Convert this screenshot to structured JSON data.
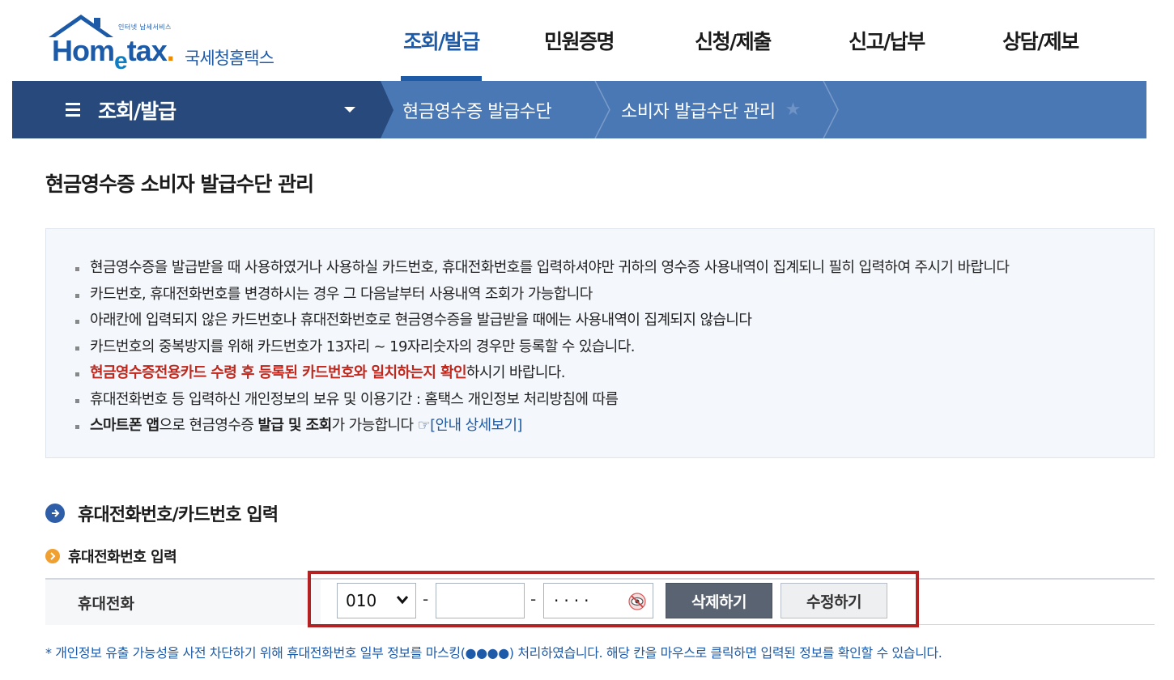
{
  "logo": {
    "tagline": "인터넷 납세서비스",
    "brand": "Hometax",
    "brand_ko": "국세청홈택스"
  },
  "gnb": [
    {
      "label": "조회/발급",
      "active": true
    },
    {
      "label": "민원증명"
    },
    {
      "label": "신청/제출"
    },
    {
      "label": "신고/납부"
    },
    {
      "label": "상담/제보"
    }
  ],
  "breadcrumb": {
    "menu_label": "조회/발급",
    "items": [
      "현금영수증 발급수단",
      "소비자 발급수단 관리"
    ]
  },
  "page_title": "현금영수증 소비자 발급수단 관리",
  "info": {
    "line1": "현금영수증을 발급받을 때 사용하였거나 사용하실 카드번호, 휴대전화번호를 입력하셔야만 귀하의 영수증 사용내역이 집계되니 필히 입력하여 주시기 바랍니다",
    "line2": "카드번호, 휴대전화번호를 변경하시는 경우 그 다음날부터 사용내역 조회가 가능합니다",
    "line3": "아래칸에 입력되지 않은 카드번호나 휴대전화번호로 현금영수증을 발급받을 때에는 사용내역이 집계되지 않습니다",
    "line4": "카드번호의 중복방지를 위해 카드번호가 13자리 ~ 19자리숫자의 경우만 등록할 수 있습니다.",
    "line5_red": "현금영수증전용카드 수령 후 등록된 카드번호와 일치하는지 확인",
    "line5_rest": "하시기 바랍니다.",
    "line6": "휴대전화번호 등 입력하신 개인정보의 보유 및 이용기간 : 홈택스 개인정보 처리방침에 따름",
    "line7_b1": "스마트폰 앱",
    "line7_t1": "으로 현금영수증 ",
    "line7_b2": "발급 및 조회",
    "line7_t2": "가 가능합니다 ",
    "line7_link": "☞[안내 상세보기]"
  },
  "section_title": "휴대전화번호/카드번호 입력",
  "sub_title": "휴대전화번호 입력",
  "phone": {
    "label": "휴대전화",
    "prefix": "010",
    "middle": "",
    "last_masked": "····",
    "dash": "-",
    "delete_label": "삭제하기",
    "edit_label": "수정하기"
  },
  "note": "* 개인정보 유출 가능성을 사전 차단하기 위해 휴대전화번호 일부 정보를 마스킹(●●●●) 처리하였습니다. 해당 칸을 마우스로 클릭하면 입력된 정보를 확인할 수 있습니다.",
  "colors": {
    "brand": "#1d5ba8",
    "nav_dark": "#27497b",
    "nav_light": "#4a78b4",
    "alert": "#c0281e",
    "highlight": "#b22222"
  }
}
